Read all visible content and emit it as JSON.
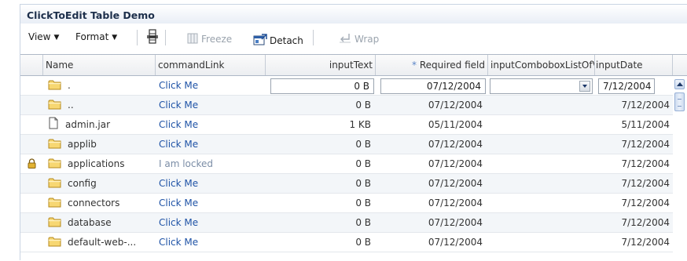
{
  "panel": {
    "title": "ClickToEdit Table Demo"
  },
  "toolbar": {
    "view_label": "View",
    "format_label": "Format",
    "freeze_label": "Freeze",
    "detach_label": "Detach",
    "wrap_label": "Wrap",
    "icons": [
      "freeze-columns-icon",
      "freeze-icon",
      "detach-icon",
      "wrap-icon"
    ]
  },
  "table": {
    "columns": {
      "name": "Name",
      "commandLink": "commandLink",
      "inputText": "inputText",
      "required_star": "*",
      "required": "Required field",
      "combo": "inputComboboxListOfValues",
      "inputDate": "inputDate"
    },
    "rows": [
      {
        "name": ".",
        "link": "Click Me",
        "size": "0 B",
        "req": "07/12/2004",
        "combo": "",
        "date": "7/12/2004",
        "icon": "folder-icon",
        "locked": false,
        "editing": true
      },
      {
        "name": "..",
        "link": "Click Me",
        "size": "0 B",
        "req": "07/12/2004",
        "combo": "",
        "date": "7/12/2004",
        "icon": "folder-icon",
        "locked": false,
        "editing": false
      },
      {
        "name": "admin.jar",
        "link": "Click Me",
        "size": "1 KB",
        "req": "05/11/2004",
        "combo": "",
        "date": "5/11/2004",
        "icon": "file-icon",
        "locked": false,
        "editing": false
      },
      {
        "name": "applib",
        "link": "Click Me",
        "size": "0 B",
        "req": "07/12/2004",
        "combo": "",
        "date": "7/12/2004",
        "icon": "folder-icon",
        "locked": false,
        "editing": false
      },
      {
        "name": "applications",
        "link": "I am locked",
        "size": "0 B",
        "req": "07/12/2004",
        "combo": "",
        "date": "7/12/2004",
        "icon": "folder-icon",
        "locked": true,
        "editing": false
      },
      {
        "name": "config",
        "link": "Click Me",
        "size": "0 B",
        "req": "07/12/2004",
        "combo": "",
        "date": "7/12/2004",
        "icon": "folder-icon",
        "locked": false,
        "editing": false
      },
      {
        "name": "connectors",
        "link": "Click Me",
        "size": "0 B",
        "req": "07/12/2004",
        "combo": "",
        "date": "7/12/2004",
        "icon": "folder-icon",
        "locked": false,
        "editing": false
      },
      {
        "name": "database",
        "link": "Click Me",
        "size": "0 B",
        "req": "07/12/2004",
        "combo": "",
        "date": "7/12/2004",
        "icon": "folder-icon",
        "locked": false,
        "editing": false
      },
      {
        "name": "default-web-...",
        "link": "Click Me",
        "size": "0 B",
        "req": "07/12/2004",
        "combo": "",
        "date": "7/12/2004",
        "icon": "folder-icon",
        "locked": false,
        "editing": false
      }
    ]
  },
  "colors": {
    "link": "#1f53a6",
    "locked_text": "#7b8da6",
    "required_star": "#5a85c7",
    "folder": "#f4c451",
    "alt_row": "#f3f6f9"
  }
}
